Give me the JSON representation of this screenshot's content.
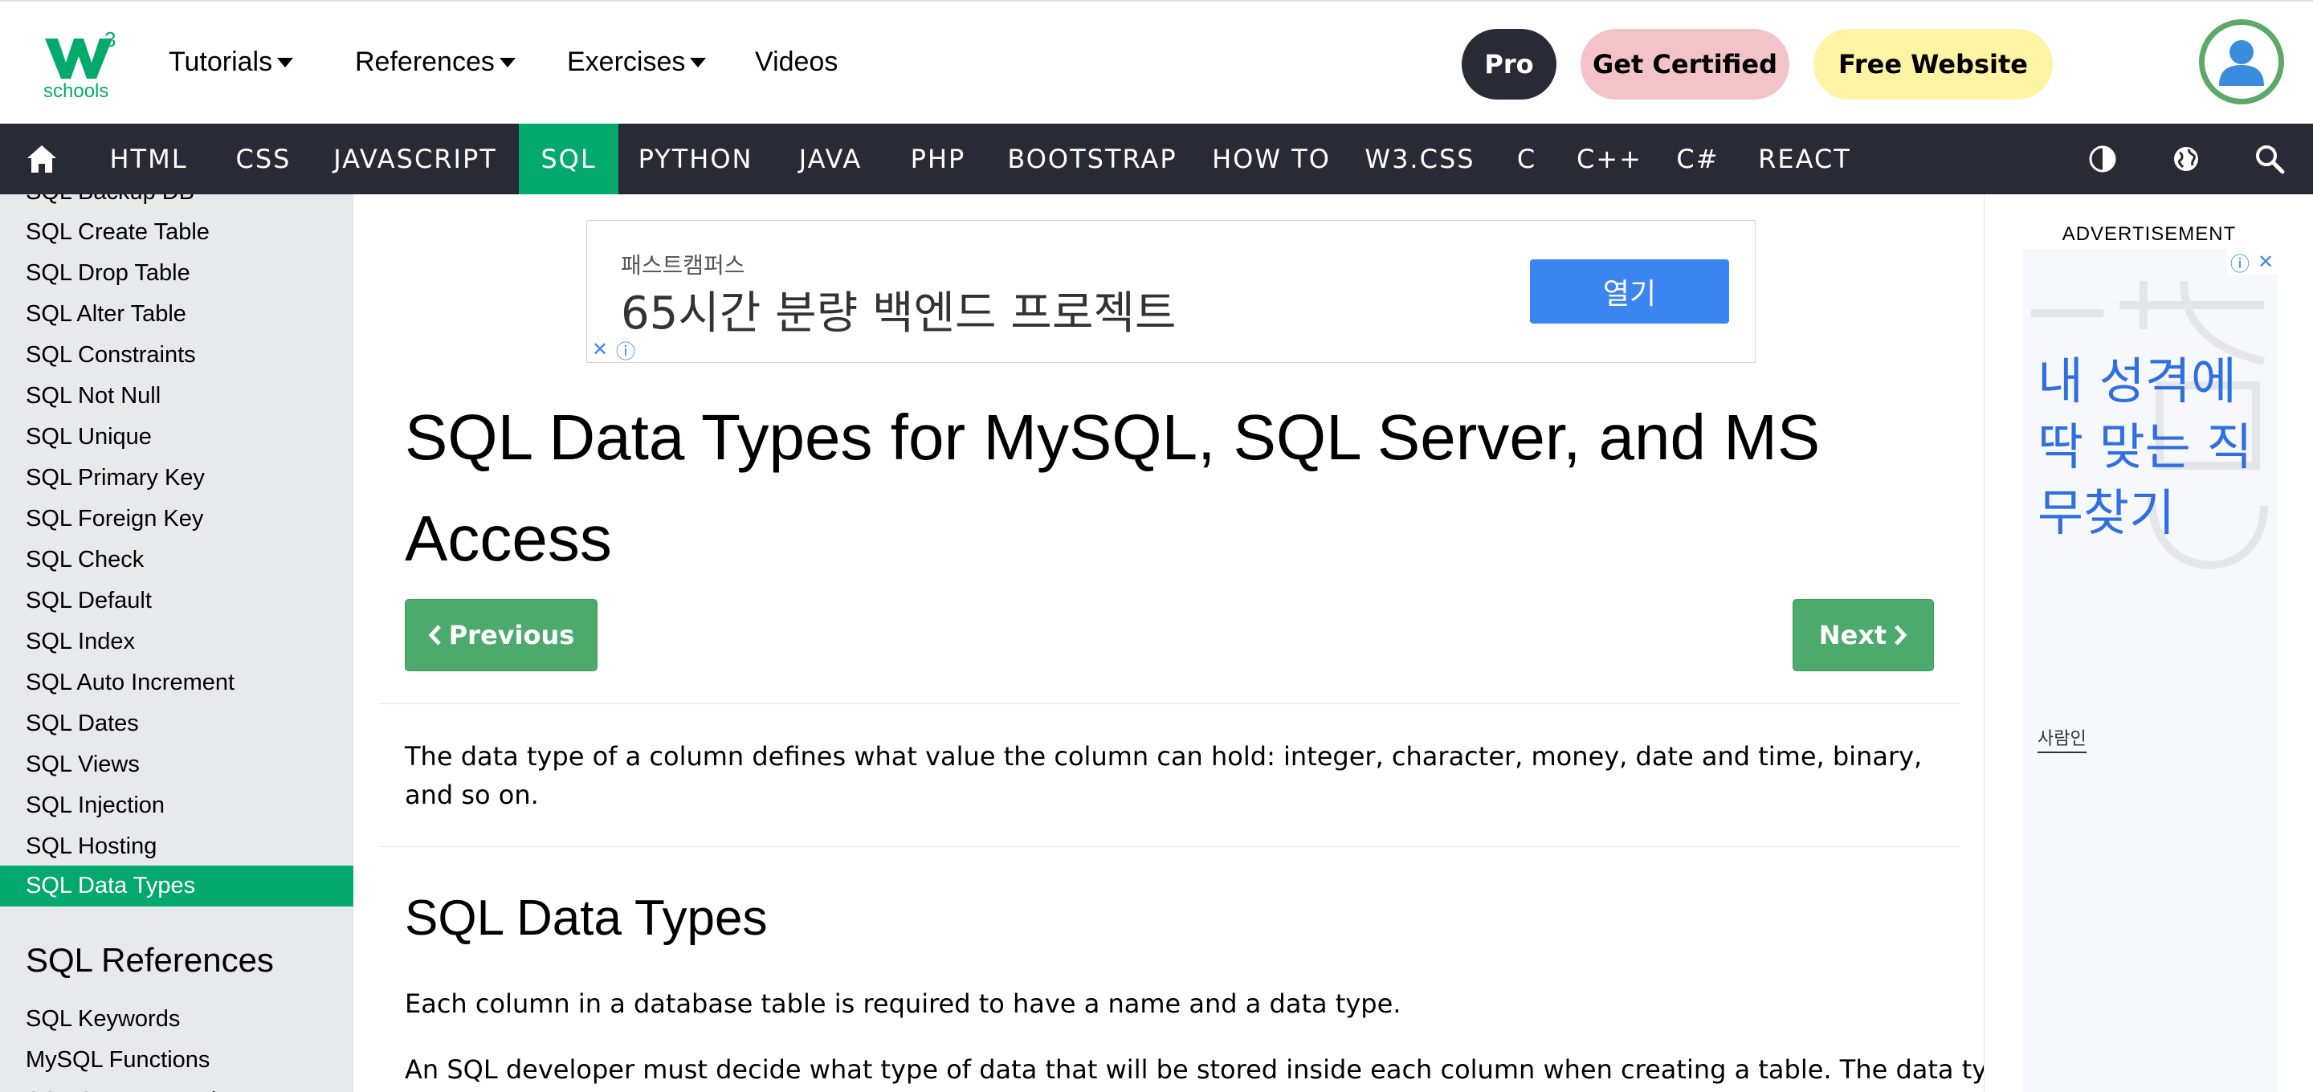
{
  "header": {
    "logo_superscript": "3",
    "logo_word": "schools",
    "nav": [
      {
        "label": "Tutorials"
      },
      {
        "label": "References"
      },
      {
        "label": "Exercises"
      },
      {
        "label": "Videos"
      }
    ],
    "pro_label": "Pro",
    "certified_label": "Get Certified",
    "free_website_label": "Free Website"
  },
  "subnav": {
    "items": [
      "HTML",
      "CSS",
      "JAVASCRIPT",
      "SQL",
      "PYTHON",
      "JAVA",
      "PHP",
      "BOOTSTRAP",
      "HOW TO",
      "W3.CSS",
      "C",
      "C++",
      "C#",
      "REACT"
    ],
    "active": "SQL"
  },
  "sidebar": {
    "partial_top_item": "SQL Backup DB",
    "items": [
      "SQL Create Table",
      "SQL Drop Table",
      "SQL Alter Table",
      "SQL Constraints",
      "SQL Not Null",
      "SQL Unique",
      "SQL Primary Key",
      "SQL Foreign Key",
      "SQL Check",
      "SQL Default",
      "SQL Index",
      "SQL Auto Increment",
      "SQL Dates",
      "SQL Views",
      "SQL Injection",
      "SQL Hosting",
      "SQL Data Types"
    ],
    "active_item": "SQL Data Types",
    "references_heading": "SQL References",
    "reference_items": [
      "SQL Keywords",
      "MySQL Functions",
      "SQL Server Functions"
    ]
  },
  "top_ad": {
    "brand": "패스트캠퍼스",
    "headline": "65시간 분량 백엔드 프로젝트",
    "button": "열기",
    "close_glyph": "✕",
    "info_glyph": "ⓘ"
  },
  "main": {
    "title": "SQL Data Types for MySQL, SQL Server, and MS Access",
    "prev_label": "Previous",
    "next_label": "Next",
    "intro": "The data type of a column defines what value the column can hold: integer, character, money, date and time, binary, and so on.",
    "section_title": "SQL Data Types",
    "para1": "Each column in a database table is required to have a name and a data type.",
    "para2": "An SQL developer must decide what type of data that will be stored inside each column when creating a table. The data type"
  },
  "right_ad": {
    "label": "ADVERTISEMENT",
    "text": "내 성격에 딱 맞는 직무찾기",
    "brand": "사람인",
    "info_glyph": "ⓘ",
    "close_glyph": "✕"
  },
  "colors": {
    "brand_green": "#04aa6d",
    "dark_nav": "#282a35",
    "button_green": "#4caa6d",
    "pink": "#f4c3c8",
    "yellow": "#fff4a3",
    "ad_blue": "#3b85f0"
  }
}
